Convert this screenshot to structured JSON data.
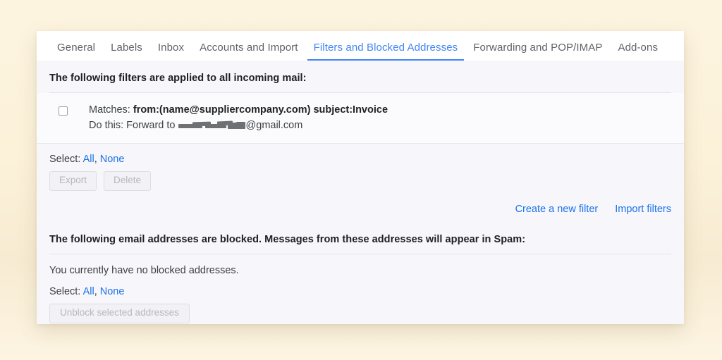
{
  "tabs": [
    {
      "label": "General",
      "active": false
    },
    {
      "label": "Labels",
      "active": false
    },
    {
      "label": "Inbox",
      "active": false
    },
    {
      "label": "Accounts and Import",
      "active": false
    },
    {
      "label": "Filters and Blocked Addresses",
      "active": true
    },
    {
      "label": "Forwarding and POP/IMAP",
      "active": false
    },
    {
      "label": "Add-ons",
      "active": false
    }
  ],
  "filters_section": {
    "heading": "The following filters are applied to all incoming mail:",
    "rows": [
      {
        "matches_label": "Matches:",
        "matches_value": "from:(name@suppliercompany.com) subject:Invoice",
        "action_label": "Do this: Forward to",
        "action_value_redacted": true,
        "action_value_suffix": "@gmail.com"
      }
    ],
    "select_label": "Select:",
    "select_all": "All",
    "select_separator": ",",
    "select_none": "None",
    "export_button": "Export",
    "delete_button": "Delete",
    "create_filter_link": "Create a new filter",
    "import_filters_link": "Import filters"
  },
  "blocked_section": {
    "heading": "The following email addresses are blocked. Messages from these addresses will appear in Spam:",
    "empty_message": "You currently have no blocked addresses.",
    "select_label": "Select:",
    "select_all": "All",
    "select_separator": ",",
    "select_none": "None",
    "unblock_button": "Unblock selected addresses"
  },
  "colors": {
    "accent": "#4285f4",
    "link": "#1a73e8",
    "page_background": "#fcf2da",
    "card_background": "#f7f6fb",
    "text_primary": "#202124",
    "text_secondary": "#3c4043",
    "disabled_text": "#b6b8bd"
  }
}
